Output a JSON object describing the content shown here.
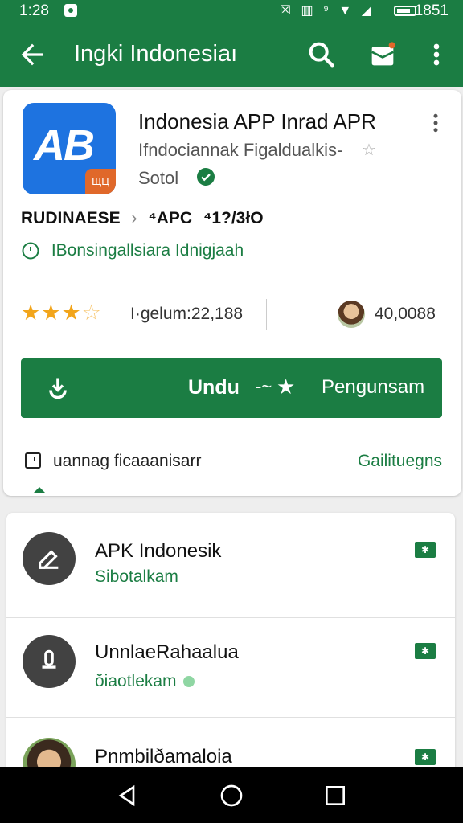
{
  "status_bar": {
    "time": "1:28",
    "icons_text": "☒ ▥ ⁹ ▼ ◢",
    "battery_pct": "1851"
  },
  "app_bar": {
    "title": "Ingki Indonesiaı"
  },
  "app": {
    "icon_text": "AB",
    "icon_tag": "ЩЦ",
    "title": "Indonesia APP Inrad APR",
    "subtitle": "Ifndociannak Figaldualkis-",
    "developer": "Sotol",
    "breadcrumb": [
      "RUDINAESE",
      "›",
      "⁴APC",
      "⁴1?/3łO"
    ],
    "info_text": "IBonsingallsiara Idnigjaah",
    "rating_stars": 3,
    "rating_text": "I·gelum:22,188",
    "downloads": "40,0088",
    "install_label": "Undu",
    "install_mid": "-~",
    "install_right": "Pengunsam",
    "footer_text": "uannag ficaaanisarr",
    "footer_link": "Gailituegns"
  },
  "list": [
    {
      "name": "APK Indonesik",
      "sub": "Sibotalkam",
      "badge": "✱"
    },
    {
      "name": "UnnlaeRahaalua",
      "sub": "ŏiaotlekam",
      "badge": "✱"
    },
    {
      "name": "Pnmbilðamaloia",
      "sub": "",
      "badge": "✱"
    }
  ],
  "colors": {
    "primary": "#1b7d43",
    "star": "#f2a51b",
    "app_icon": "#1e73e0",
    "app_icon_tag": "#e0682a"
  }
}
